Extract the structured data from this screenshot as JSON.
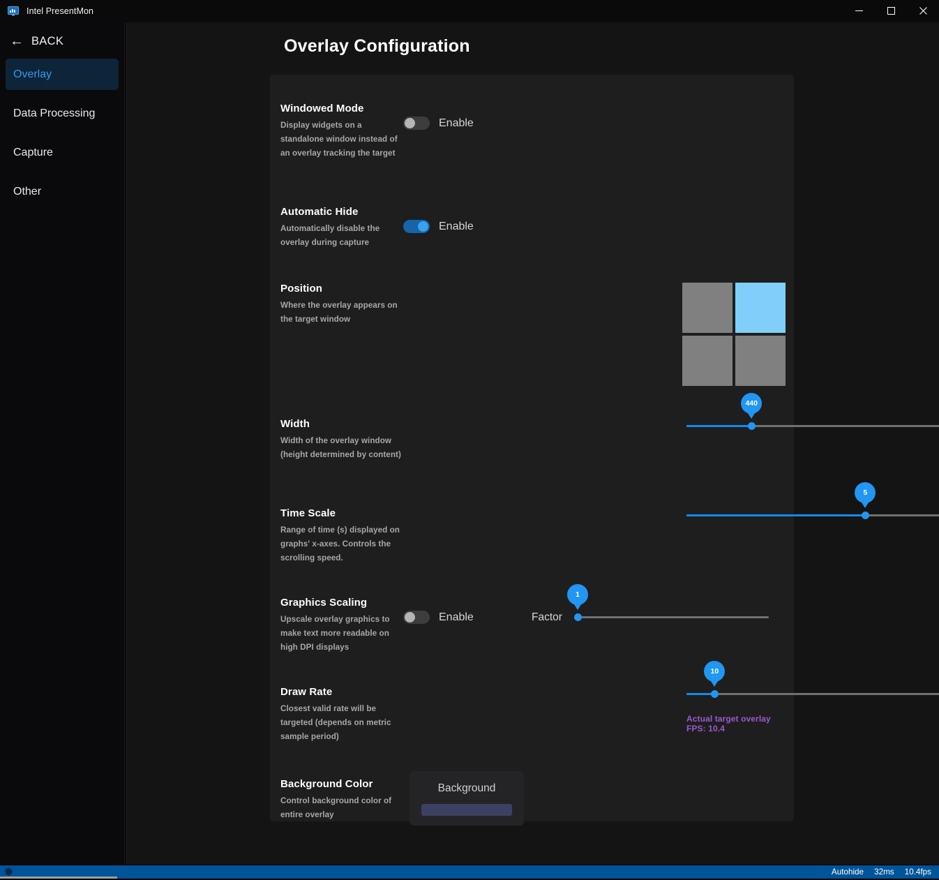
{
  "window": {
    "title": "Intel PresentMon",
    "icon": "app-monitor-chart-icon",
    "controls": {
      "minimize": "─",
      "maximize": "□",
      "close": "✕"
    }
  },
  "sidebar": {
    "back": {
      "label": "BACK",
      "icon": "arrow-left-icon",
      "arrow": "←"
    },
    "items": [
      {
        "label": "Overlay",
        "active": true
      },
      {
        "label": "Data Processing",
        "active": false
      },
      {
        "label": "Capture",
        "active": false
      },
      {
        "label": "Other",
        "active": false
      }
    ]
  },
  "main": {
    "page_title": "Overlay Configuration",
    "settings": [
      {
        "id": "windowed-mode",
        "title": "Windowed Mode",
        "desc": "Display widgets on a standalone window instead of an overlay tracking the target",
        "toggle": {
          "label": "Enable",
          "on": false
        }
      },
      {
        "id": "automatic-hide",
        "title": "Automatic Hide",
        "desc": "Automatically disable the overlay during capture",
        "toggle": {
          "label": "Enable",
          "on": true
        }
      },
      {
        "id": "position",
        "title": "Position",
        "desc": "Where the overlay appears on the target window",
        "grid": {
          "cells": [
            "top-left",
            "top-right",
            "bottom-left",
            "bottom-right"
          ],
          "selected": "top-right"
        }
      },
      {
        "id": "width",
        "title": "Width",
        "desc": "Width of the overlay window (height determined by content)",
        "slider": {
          "value": "440",
          "percent": 18
        }
      },
      {
        "id": "time-scale",
        "title": "Time Scale",
        "desc": "Range of time (s) displayed on graphs' x-axes. Controls the scrolling speed.",
        "slider": {
          "value": "5",
          "percent": 49.5
        }
      },
      {
        "id": "graphics-scaling",
        "title": "Graphics Scaling",
        "desc": "Upscale overlay graphics to make text more readable on high DPI displays",
        "toggle": {
          "label": "Enable",
          "on": false
        },
        "factor_label": "Factor",
        "slider": {
          "value": "1",
          "percent": 0
        }
      },
      {
        "id": "draw-rate",
        "title": "Draw Rate",
        "desc": "Closest valid rate will be targeted (depends on metric sample period)",
        "slider": {
          "value": "10",
          "percent": 7.8
        },
        "note": "Actual target overlay FPS: 10.4"
      },
      {
        "id": "background-color",
        "title": "Background Color",
        "desc": "Control background color of entire overlay",
        "button": {
          "label": "Background",
          "swatch_color": "#3c4163"
        }
      }
    ]
  },
  "statusbar": {
    "gear_icon": "gear-icon",
    "autohide": "Autohide",
    "latency": "32ms",
    "fps": "10.4fps"
  },
  "colors": {
    "accent": "#2196f3",
    "accent_dark": "#0f8bf0",
    "selected_cell": "#81cefa",
    "note_purple": "#9b59d0",
    "statusbar_blue": "#005499",
    "nav_active_bg": "#0e2439",
    "nav_active_text": "#2f9aee"
  }
}
